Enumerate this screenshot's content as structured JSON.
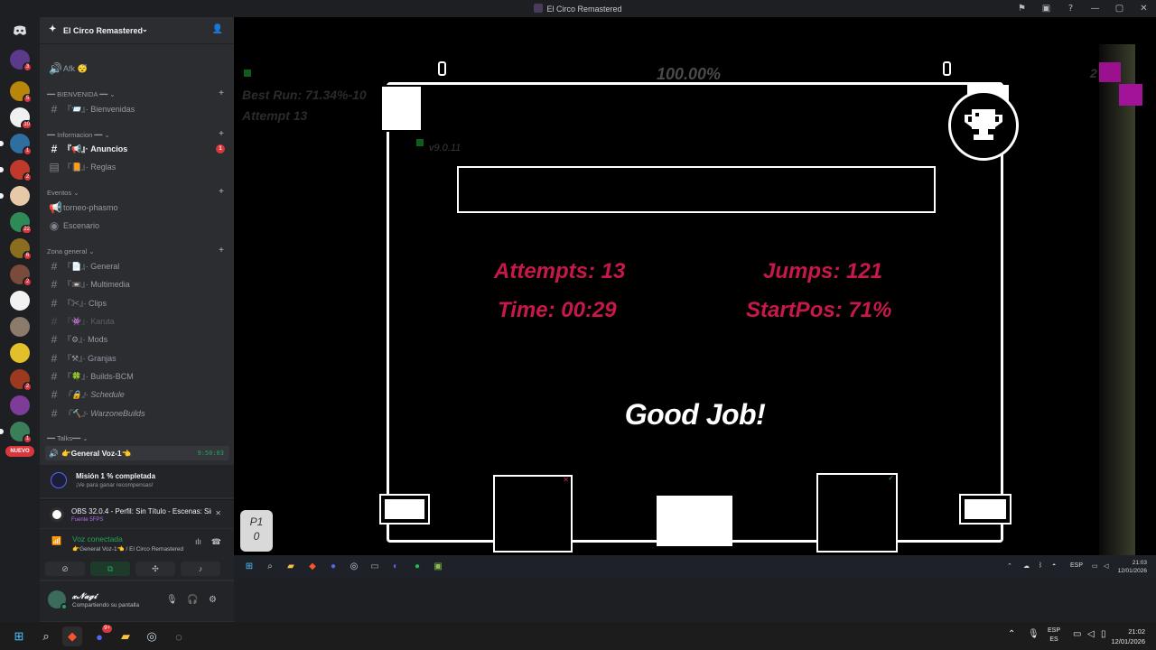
{
  "window": {
    "title": "El Circo Remastered"
  },
  "server": {
    "name": "El Circo Remastered"
  },
  "rail": {
    "badges": [
      "3",
      "5",
      "10",
      "1",
      "2",
      "22",
      "6",
      "2",
      "2",
      "1"
    ],
    "new_label": "NUEVO"
  },
  "channels": {
    "afk": "Afk 😴",
    "cat_bienvenida": "━━ BIENVENIDA ━━",
    "bienvenidas": "『📨』· Bienvenidas",
    "cat_informacion": "━━ Informacion ━━",
    "anuncios": "『📢』· Anuncios",
    "anuncios_badge": "1",
    "reglas": "『📙』· Reglas",
    "cat_eventos": "Eventos",
    "torneo": "torneo-phasmo",
    "escenario": "Escenario",
    "cat_zona": "Zona general",
    "general": "『📄』· General",
    "multimedia": "『📼』· Multimedia",
    "clips": "『✂』· Clips",
    "karuta": "『👾』· Karuta",
    "mods": "『⚙』· Mods",
    "granjas": "『⚒』· Granjas",
    "builds": "『🍀』· Builds-BCM",
    "schedule": "『🔒』· Schedule",
    "warzone": "『🔨』· WarzoneBuilds",
    "cat_talks": "━━ Talks━━"
  },
  "voice": {
    "channel_label": "👉General Voz-1👈",
    "timer": "9:50:03"
  },
  "mission": {
    "title": "Misión 1 % completada",
    "subtitle": "¡Ve para ganar recompensas!"
  },
  "obs": {
    "title": "OBS 32.0.4 - Perfil: Sin Título - Escenas: Sin ...",
    "subtitle": "Fuente 5FPS"
  },
  "voice_connected": {
    "title": "Voz conectada",
    "subtitle": "👉General Voz-1👈 / El Circo Remastered"
  },
  "user": {
    "name": "𝔁𝓝𝓪𝓰𝓲",
    "status": "Compartiendo su pantalla"
  },
  "game": {
    "best_run": "Best Run: 71.34%-10",
    "attempt": "Attempt 13",
    "version": "v9.0.11",
    "percent": "100.00%",
    "fps": "2",
    "stats": {
      "attempts": "Attempts: 13",
      "jumps": "Jumps: 121",
      "time": "Time: 00:29",
      "startpos": "StartPos: 71%"
    },
    "message": "Good Job!",
    "p1_label": "P1",
    "p1_value": "0"
  },
  "inner_taskbar": {
    "lang": "ESP",
    "time": "21:03",
    "date": "12/01/2026"
  },
  "taskbar": {
    "lang_top": "ESP",
    "lang_bottom": "ES",
    "time": "21:02",
    "date": "12/01/2026",
    "discord_badge": "9+"
  },
  "colors": {
    "stat_red": "#c8184a",
    "discord_green": "#23a55a",
    "badge_red": "#da373c"
  }
}
